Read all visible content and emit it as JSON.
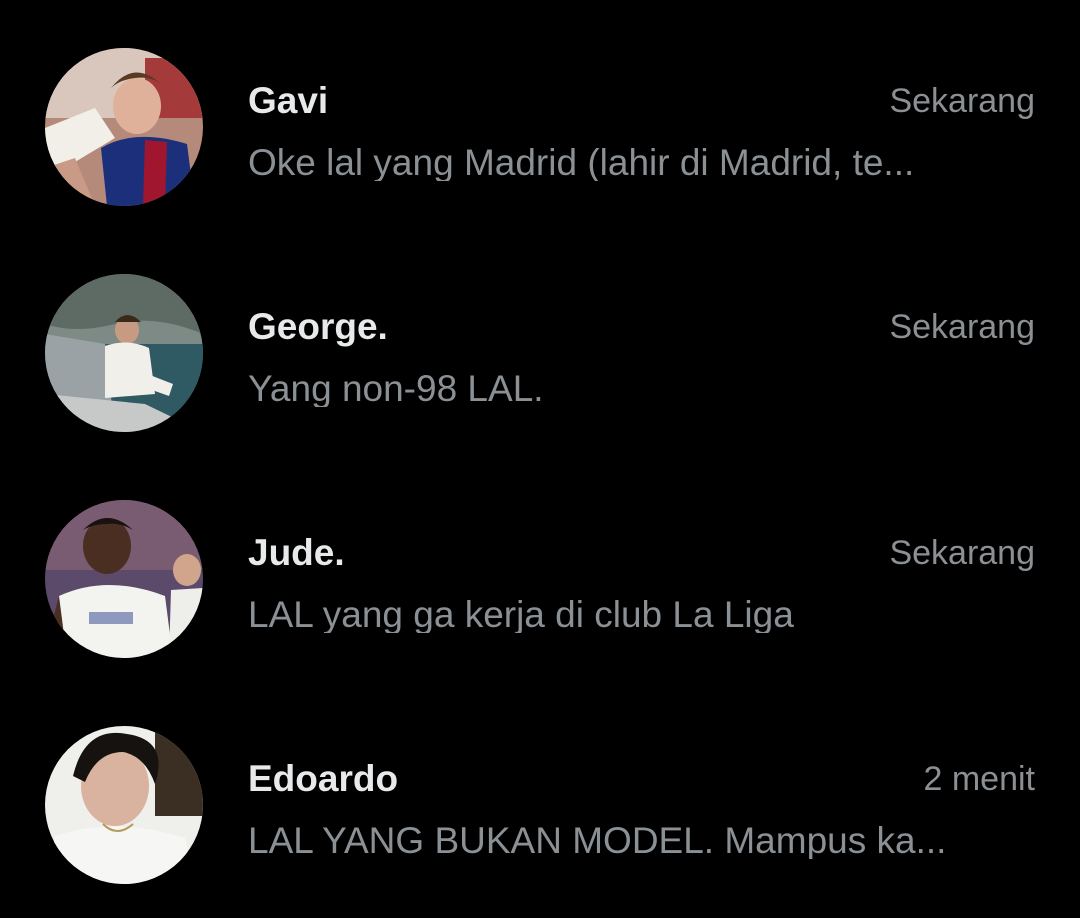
{
  "conversations": [
    {
      "name": "Gavi",
      "time": "Sekarang",
      "preview": "Oke lal yang Madrid (lahir di Madrid, te...",
      "avatar_icon": "avatar-gavi"
    },
    {
      "name": "George.",
      "time": "Sekarang",
      "preview": "Yang non-98 LAL.",
      "avatar_icon": "avatar-george"
    },
    {
      "name": "Jude.",
      "time": "Sekarang",
      "preview": "LAL yang ga kerja di club La Liga",
      "avatar_icon": "avatar-jude"
    },
    {
      "name": "Edoardo",
      "time": "2 menit",
      "preview": "LAL YANG BUKAN MODEL. Mampus ka...",
      "avatar_icon": "avatar-edoardo"
    }
  ],
  "colors": {
    "background": "#000000",
    "name_text": "#e7e9ea",
    "secondary_text": "#8b9095"
  }
}
